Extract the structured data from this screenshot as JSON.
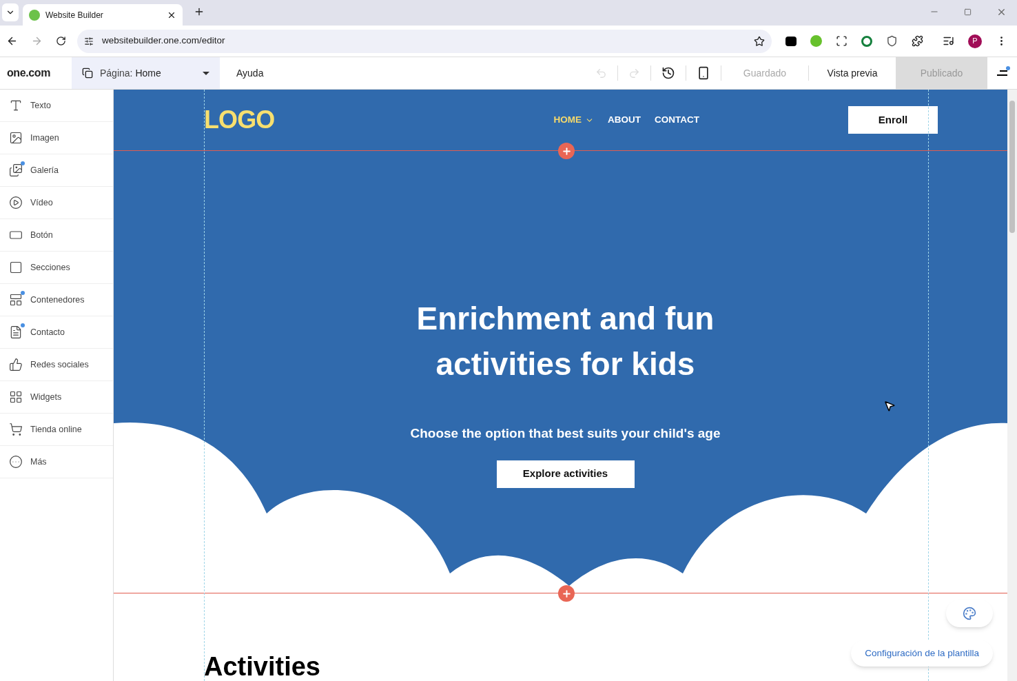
{
  "browser": {
    "tab_title": "Website Builder",
    "url": "websitebuilder.one.com/editor",
    "profile_initial": "P"
  },
  "editor": {
    "logo": "one.com",
    "page_label": "Página:",
    "page_name": "Home",
    "help": "Ayuda",
    "undo_disabled": true,
    "redo_disabled": true,
    "saved": "Guardado",
    "preview": "Vista previa",
    "publish": "Publicado",
    "publish_disabled": true,
    "menu_notification": true
  },
  "sidebar": {
    "items": [
      {
        "label": "Texto",
        "dot": false
      },
      {
        "label": "Imagen",
        "dot": false
      },
      {
        "label": "Galería",
        "dot": true
      },
      {
        "label": "Vídeo",
        "dot": false
      },
      {
        "label": "Botón",
        "dot": false
      },
      {
        "label": "Secciones",
        "dot": false
      },
      {
        "label": "Contenedores",
        "dot": true
      },
      {
        "label": "Contacto",
        "dot": true
      },
      {
        "label": "Redes sociales",
        "dot": false
      },
      {
        "label": "Widgets",
        "dot": false
      },
      {
        "label": "Tienda online",
        "dot": false
      },
      {
        "label": "Más",
        "dot": false
      }
    ]
  },
  "site": {
    "logo": "LOGO",
    "nav": [
      {
        "label": "HOME",
        "selected": true,
        "has_submenu": true
      },
      {
        "label": "ABOUT",
        "selected": false,
        "has_submenu": false
      },
      {
        "label": "CONTACT",
        "selected": false,
        "has_submenu": false
      }
    ],
    "header_button": "Enroll",
    "hero_title": "Enrichment and fun activities for kids",
    "hero_subtitle": "Choose the option that best suits your child's age",
    "hero_button": "Explore activities",
    "section_title": "Activities"
  },
  "template_settings": "Configuración de la plantilla"
}
